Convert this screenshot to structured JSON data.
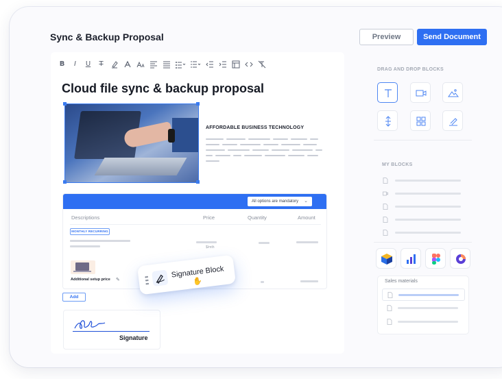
{
  "header": {
    "title": "Sync & Backup Proposal",
    "preview_label": "Preview",
    "send_label": "Send Document"
  },
  "toolbar": {
    "icons": [
      "bold-icon",
      "italic-icon",
      "underline-icon",
      "strikethrough-icon",
      "highlight-icon",
      "text-color-icon",
      "font-size-icon",
      "align-left-icon",
      "align-justify-icon",
      "bulleted-list-icon",
      "numbered-list-icon",
      "indent-decrease-icon",
      "indent-increase-icon",
      "table-icon",
      "code-icon",
      "clear-format-icon"
    ],
    "glyphs": {
      "bold": "B",
      "italic": "I",
      "underline": "U",
      "strike": "T"
    }
  },
  "document": {
    "title": "Cloud file sync & backup proposal",
    "section_heading": "AFFORDABLE BUSINESS TECHNOLOGY"
  },
  "pricing_table": {
    "dropdown": "All options are mandatory",
    "columns": [
      "Descriptions",
      "Price",
      "Quantity",
      "Amount"
    ],
    "badge": "MONTHLY RECURRING",
    "per_unit": "$/mth",
    "additional_item": "Additional setup price"
  },
  "add_label": "Add",
  "signature": {
    "label": "Signature",
    "chip_label": "Signature Block"
  },
  "sidebar": {
    "drag_drop_label": "DRAG AND DROP BLOCKS",
    "blocks": [
      "text-icon",
      "video-icon",
      "image-icon",
      "spacer-icon",
      "layout-icon",
      "signature-icon"
    ],
    "my_blocks_label": "MY BLOCKS",
    "my_blocks": [
      "document-icon",
      "video-icon",
      "document-icon",
      "document-icon",
      "document-icon"
    ],
    "apps": [
      "box-app-icon",
      "analytics-app-icon",
      "figma-app-icon",
      "pie-app-icon"
    ],
    "sales_materials_label": "Sales materials"
  },
  "colors": {
    "accent": "#2e6ff2",
    "signature_ink": "#1e4fd8"
  }
}
